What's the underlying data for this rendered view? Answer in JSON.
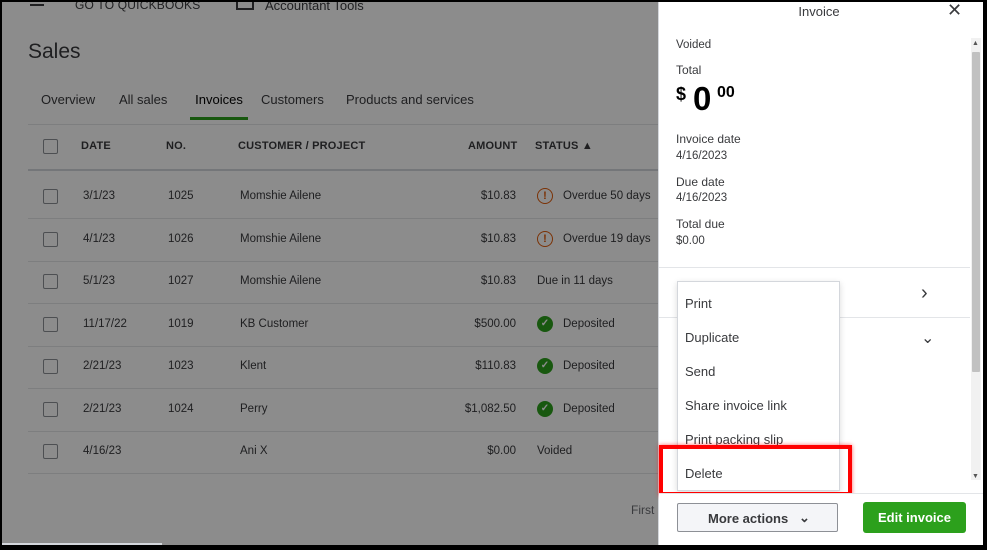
{
  "topbar": {
    "goto": "GO TO QUICKBOOKS",
    "accountant_tools": "Accountant Tools"
  },
  "page": {
    "title": "Sales"
  },
  "tabs": [
    {
      "label": "Overview"
    },
    {
      "label": "All sales"
    },
    {
      "label": "Invoices",
      "active": true
    },
    {
      "label": "Customers"
    },
    {
      "label": "Products and services"
    }
  ],
  "table": {
    "headers": {
      "date": "DATE",
      "no": "NO.",
      "customer": "CUSTOMER / PROJECT",
      "amount": "AMOUNT",
      "status": "STATUS ▲"
    },
    "rows": [
      {
        "date": "3/1/23",
        "no": "1025",
        "customer": "Momshie Ailene",
        "amount": "$10.83",
        "status": "Overdue 50 days",
        "status_icon": "overdue"
      },
      {
        "date": "4/1/23",
        "no": "1026",
        "customer": "Momshie Ailene",
        "amount": "$10.83",
        "status": "Overdue 19 days",
        "status_icon": "overdue"
      },
      {
        "date": "5/1/23",
        "no": "1027",
        "customer": "Momshie Ailene",
        "amount": "$10.83",
        "status": "Due in 11 days",
        "status_icon": "none"
      },
      {
        "date": "11/17/22",
        "no": "1019",
        "customer": "KB Customer",
        "amount": "$500.00",
        "status": "Deposited",
        "status_icon": "check"
      },
      {
        "date": "2/21/23",
        "no": "1023",
        "customer": "Klent",
        "amount": "$110.83",
        "status": "Deposited",
        "status_icon": "check"
      },
      {
        "date": "2/21/23",
        "no": "1024",
        "customer": "Perry",
        "amount": "$1,082.50",
        "status": "Deposited",
        "status_icon": "check"
      },
      {
        "date": "4/16/23",
        "no": "",
        "customer": "Ani X",
        "amount": "$0.00",
        "status": "Voided",
        "status_icon": "none"
      }
    ]
  },
  "pagination": {
    "first": "First"
  },
  "panel": {
    "title": "Invoice",
    "status": "Voided",
    "total_label": "Total",
    "total_currency": "$",
    "total_whole": "0",
    "total_cents": "00",
    "invoice_date_label": "Invoice date",
    "invoice_date": "4/16/2023",
    "due_date_label": "Due date",
    "due_date": "4/16/2023",
    "total_due_label": "Total due",
    "total_due": "$0.00",
    "close_glyph": "✕",
    "chevron_right": "›",
    "chevron_down": "⌄"
  },
  "more_actions_menu": {
    "items": [
      "Print",
      "Duplicate",
      "Send",
      "Share invoice link",
      "Print packing slip",
      "Delete"
    ],
    "highlighted": "Delete"
  },
  "footer": {
    "more_actions_label": "More actions",
    "edit_invoice_label": "Edit invoice"
  },
  "colors": {
    "accent_green": "#2ca01c",
    "overdue_orange": "#e05b0a",
    "highlight_red": "#ff0000"
  }
}
